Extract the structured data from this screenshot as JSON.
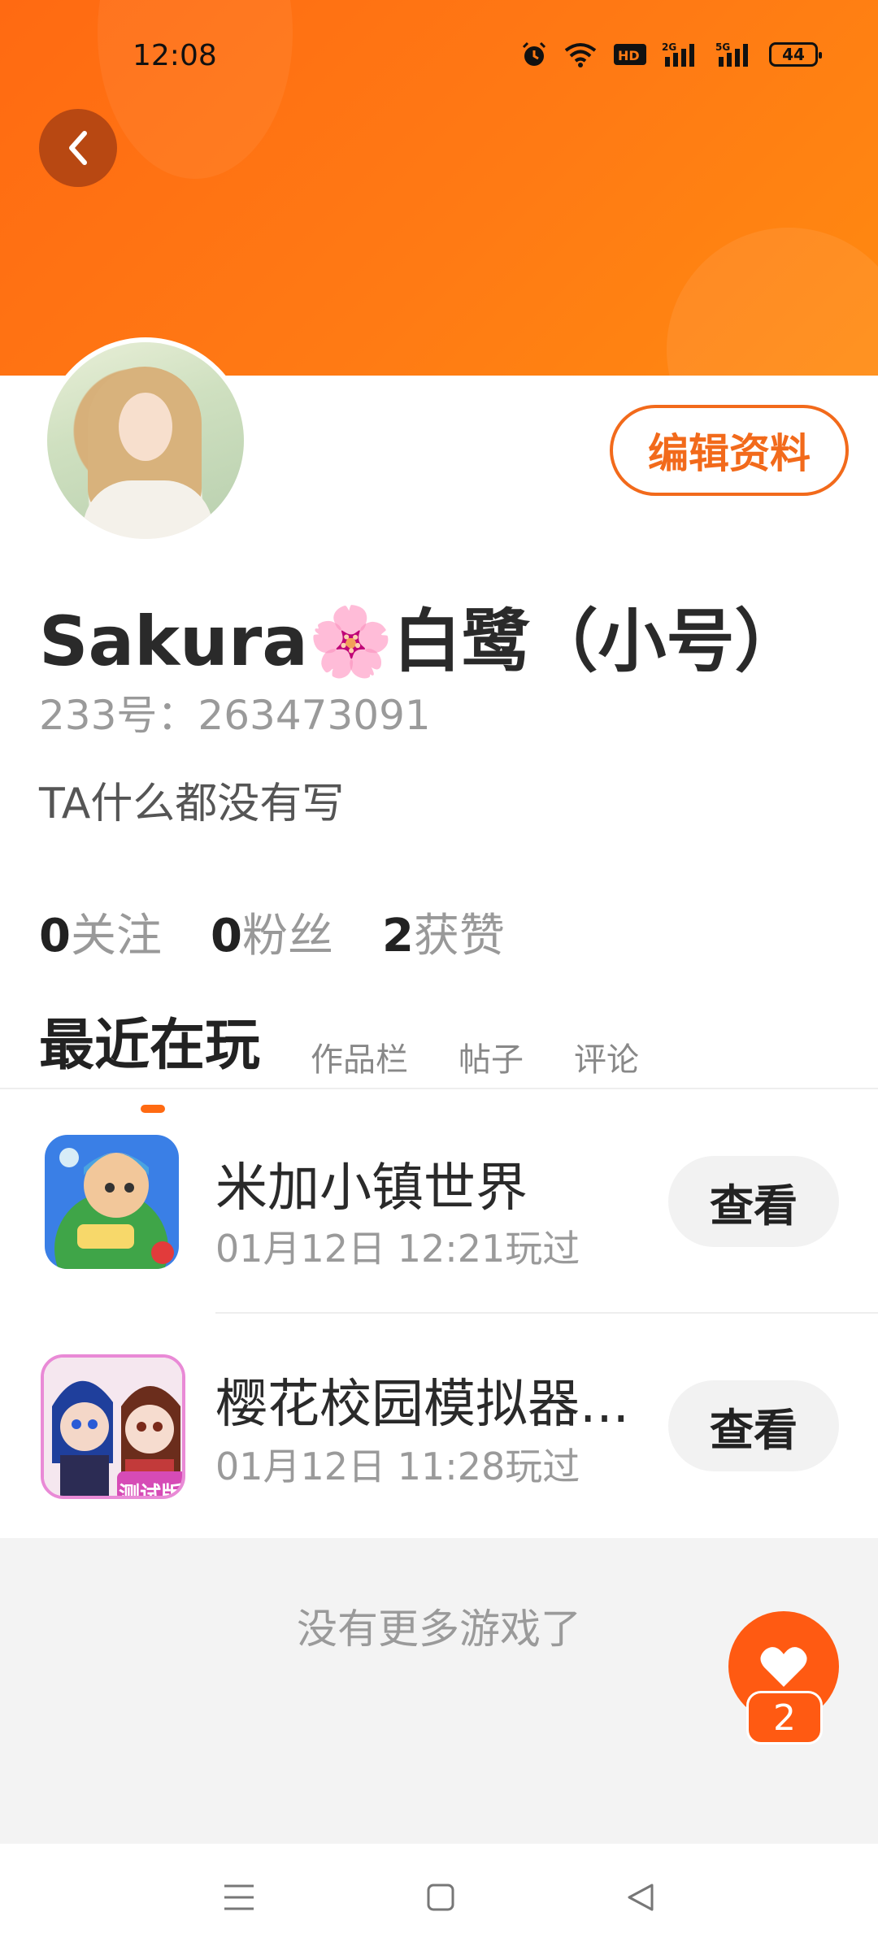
{
  "status_bar": {
    "time": "12:08",
    "icons": [
      "alarm-icon",
      "wifi-icon",
      "hd-icon",
      "signal-2g-icon",
      "signal-5g-icon"
    ],
    "battery_level": "44"
  },
  "header": {
    "back_icon": "chevron-left-icon",
    "banner_color": "#ff7a14"
  },
  "profile": {
    "edit_label": "编辑资料",
    "name": "Sakura🌸白鹭（小号）",
    "id_text": "233号：263473091",
    "bio": "TA什么都没有写"
  },
  "stats": {
    "following_count": "0",
    "following_label": "关注",
    "fans_count": "0",
    "fans_label": "粉丝",
    "likes_count": "2",
    "likes_label": "获赞"
  },
  "tabs": [
    {
      "label": "最近在玩",
      "active": true
    },
    {
      "label": "作品栏",
      "active": false
    },
    {
      "label": "帖子",
      "active": false
    },
    {
      "label": "评论",
      "active": false
    }
  ],
  "games": [
    {
      "title": "米加小镇世界",
      "time": "01月12日 12:21玩过",
      "button": "查看",
      "icon": "toca-world-icon"
    },
    {
      "title": "樱花校园模拟器...",
      "time": "01月12日 11:28玩过",
      "button": "查看",
      "icon": "sakura-school-icon",
      "badge": "测试版"
    }
  ],
  "footer": {
    "no_more_text": "没有更多游戏了"
  },
  "like_fab": {
    "icon": "heart-icon",
    "count": "2"
  },
  "nav_bar": {
    "icons": [
      "menu-icon",
      "home-square-icon",
      "back-triangle-icon"
    ]
  },
  "colors": {
    "accent": "#ff6a12",
    "text_primary": "#222222",
    "text_secondary": "#9a9a9a"
  }
}
